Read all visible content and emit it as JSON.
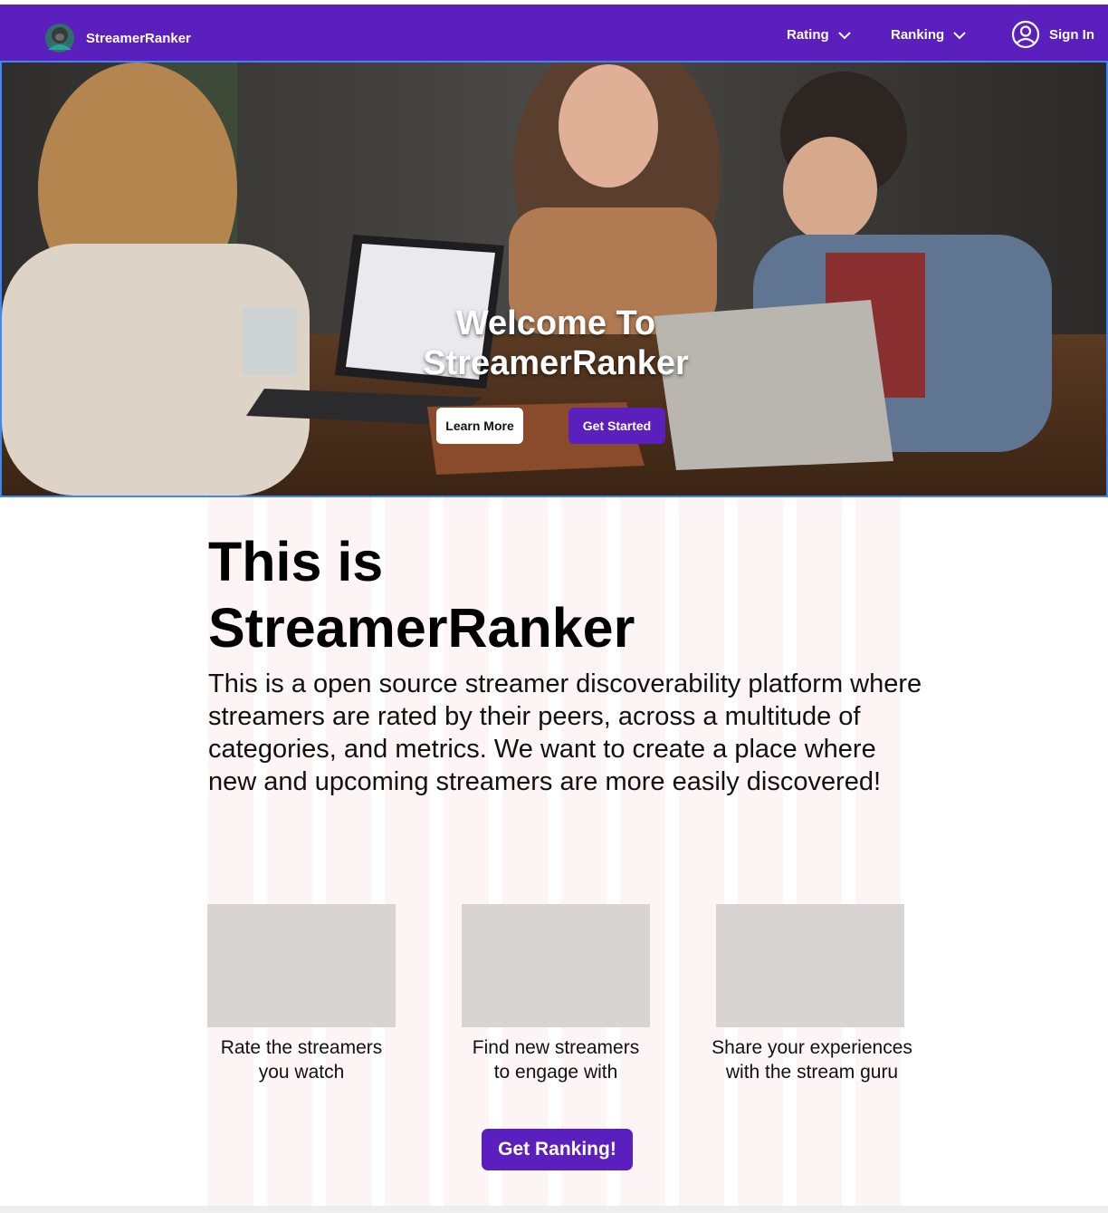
{
  "nav": {
    "brand": "StreamerRanker",
    "logo_icon": "gorilla-avatar-icon",
    "rating_label": "Rating",
    "ranking_label": "Ranking",
    "signin_label": "Sign In",
    "background": "#5b1fbd"
  },
  "hero": {
    "title_line1": "Welcome To",
    "title_line2": "StreamerRanker",
    "learn_more": "Learn More",
    "get_started": "Get Started",
    "image": "photo of three people laughing around laptops"
  },
  "main": {
    "title_line1": "This is",
    "title_line2": "StreamerRanker",
    "description": "This is a open source streamer discoverability platform where streamers are rated by their peers, across a multitude of categories, and metrics. We want to create a place where new and upcoming streamers are more easily discovered!"
  },
  "features": [
    {
      "line1": "Rate the streamers",
      "line2": "you watch"
    },
    {
      "line1": "Find new streamers",
      "line2": "to engage with"
    },
    {
      "line1": "Share your experiences",
      "line2": "with the stream guru"
    }
  ],
  "cta": {
    "label": "Get Ranking!"
  },
  "colors": {
    "accent": "#5b1fbd",
    "placeholder": "#d8d4d4",
    "hero_border": "#3f86f2"
  }
}
